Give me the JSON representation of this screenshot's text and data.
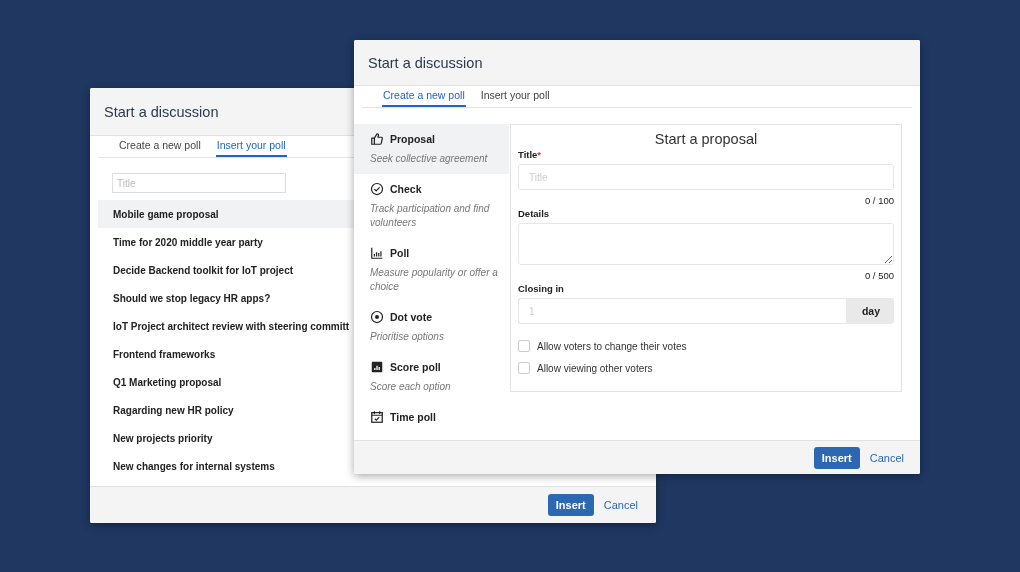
{
  "background_dialog": {
    "title": "Start a discussion",
    "tabs": [
      {
        "label": "Create a new poll",
        "selected": false
      },
      {
        "label": "Insert your poll",
        "selected": true
      }
    ],
    "search": {
      "placeholder": "Title"
    },
    "polls": [
      {
        "title": "Mobile game proposal",
        "selected": true
      },
      {
        "title": "Time for 2020 middle year party",
        "selected": false
      },
      {
        "title": "Decide Backend toolkit for IoT project",
        "selected": false
      },
      {
        "title": "Should we stop legacy HR apps?",
        "selected": false
      },
      {
        "title": "IoT Project architect review with steering committ",
        "selected": false
      },
      {
        "title": "Frontend frameworks",
        "selected": false
      },
      {
        "title": "Q1 Marketing proposal",
        "selected": false
      },
      {
        "title": "Ragarding new HR policy",
        "selected": false
      },
      {
        "title": "New projects priority",
        "selected": false
      },
      {
        "title": "New changes for internal systems",
        "selected": false
      }
    ],
    "buttons": {
      "insert": "Insert",
      "cancel": "Cancel"
    }
  },
  "dialog": {
    "title": "Start a discussion",
    "tabs": [
      {
        "label": "Create a new poll",
        "selected": true
      },
      {
        "label": "Insert your poll",
        "selected": false
      }
    ],
    "poll_types": [
      {
        "kind": "proposal",
        "name": "Proposal",
        "description": "Seek collective agreement",
        "selected": true
      },
      {
        "kind": "check",
        "name": "Check",
        "description": "Track participation and find volunteers",
        "selected": false
      },
      {
        "kind": "poll",
        "name": "Poll",
        "description": "Measure popularity or offer a choice",
        "selected": false
      },
      {
        "kind": "dot",
        "name": "Dot vote",
        "description": "Prioritise options",
        "selected": false
      },
      {
        "kind": "score",
        "name": "Score poll",
        "description": "Score each option",
        "selected": false
      },
      {
        "kind": "time",
        "name": "Time poll",
        "selected": false
      }
    ],
    "form": {
      "heading": "Start a proposal",
      "title_label": "Title",
      "required_mark": "*",
      "title_placeholder": "Title",
      "title_counter": "0 / 100",
      "details_label": "Details",
      "details_counter": "0 / 500",
      "closing_label": "Closing in",
      "closing_placeholder": "1",
      "closing_unit": "day",
      "options": [
        {
          "label": "Allow voters to change their votes",
          "checked": false
        },
        {
          "label": "Allow viewing other voters",
          "checked": false
        }
      ]
    },
    "buttons": {
      "insert": "Insert",
      "cancel": "Cancel"
    }
  }
}
